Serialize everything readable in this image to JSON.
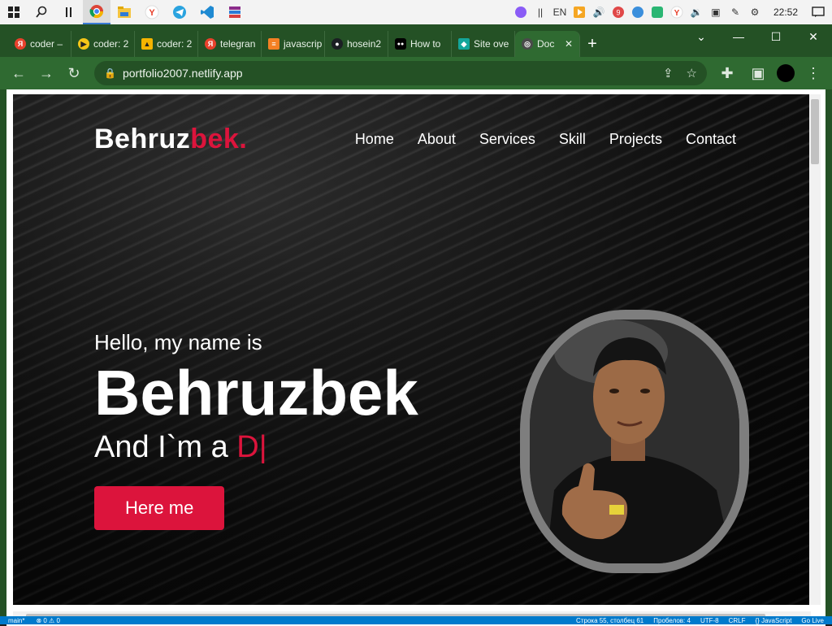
{
  "taskbar": {
    "icons": [
      "windows-icon",
      "search-icon",
      "taskview-icon",
      "chrome-icon",
      "files-icon",
      "yandex-icon",
      "telegram-icon",
      "vscode-icon",
      "winrar-icon"
    ],
    "tray": {
      "lang": "EN",
      "badge": "9",
      "time": "22:52"
    }
  },
  "browser": {
    "tabs": [
      {
        "label": "coder –",
        "favicon_color": "#e8412c",
        "favicon_text": "Я"
      },
      {
        "label": "coder: 2",
        "favicon_color": "#f5c518",
        "favicon_text": "▶"
      },
      {
        "label": "coder: 2",
        "favicon_color": "#f5b400",
        "favicon_text": "▲"
      },
      {
        "label": "telegran",
        "favicon_color": "#e8412c",
        "favicon_text": "Я"
      },
      {
        "label": "javascrip",
        "favicon_color": "#f48024",
        "favicon_text": "≡"
      },
      {
        "label": "hosein2",
        "favicon_color": "#1b1f23",
        "favicon_text": "●"
      },
      {
        "label": "How to",
        "favicon_color": "#000000",
        "favicon_text": "●●"
      },
      {
        "label": "Site ove",
        "favicon_color": "#14a69b",
        "favicon_text": "◆"
      },
      {
        "label": "Doc",
        "favicon_color": "#4a4a4a",
        "favicon_text": "◎",
        "active": true
      }
    ],
    "newtab_label": "+",
    "url": "portfolio2007.netlify.app"
  },
  "site": {
    "logo_main": "Behruz",
    "logo_accent": "bek.",
    "nav": [
      "Home",
      "About",
      "Services",
      "Skill",
      "Projects",
      "Contact"
    ],
    "hello": "Hello, my name is",
    "name": "Behruzbek",
    "role_prefix": "And I`m a ",
    "role_typed": "D|",
    "cta_label": "Here me"
  },
  "statusbar": {
    "branch": "main*",
    "errors": "⊗ 0 ⚠ 0",
    "position": "Строка 55, столбец 61",
    "spaces": "Пробелов: 4",
    "encoding": "UTF-8",
    "eol": "CRLF",
    "language": "{} JavaScript",
    "live": "Go Live"
  },
  "colors": {
    "accent": "#dc143c",
    "chrome_frame": "#245125",
    "chrome_toolbar": "#2f6a31"
  }
}
